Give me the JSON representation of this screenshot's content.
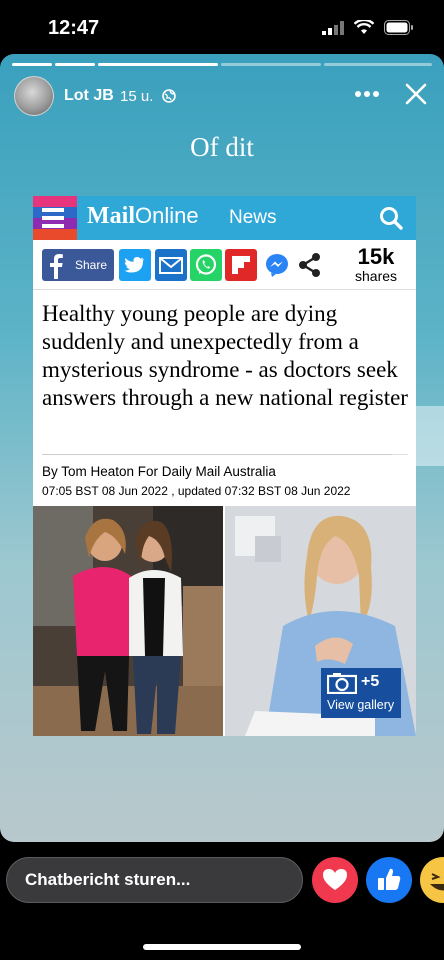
{
  "status_bar": {
    "time": "12:47"
  },
  "story": {
    "progress": {
      "segments_total": 5,
      "segments_done": 3
    },
    "user_name": "Lot JB",
    "post_time": "15 u.",
    "caption": "Of dit",
    "more_icon": "more-horizontal-icon",
    "close_icon": "close-icon"
  },
  "article": {
    "brand": "Mail",
    "brand_sub": "Online",
    "section": "News",
    "share": {
      "share_label": "Share",
      "count": "15k",
      "count_label": "shares"
    },
    "headline": "Healthy young people are dying suddenly and unexpectedly from a mysterious syndrome - as doctors seek answers through a new national register",
    "byline": "By Tom Heaton For Daily Mail Australia",
    "dateline": "07:05 BST 08 Jun 2022 , updated 07:32 BST 08 Jun 2022",
    "gallery": {
      "count": "+5",
      "label": "View gallery"
    }
  },
  "bottom": {
    "chat_placeholder": "Chatbericht sturen..."
  },
  "colors": {
    "dailymail_blue": "#2fa8d8",
    "facebook": "#3b5998",
    "twitter": "#1da1f2",
    "whatsapp": "#25d366",
    "flipboard": "#e12828",
    "gallery": "#174f9e",
    "love_react": "#f0384f",
    "like_react": "#1877f2"
  }
}
